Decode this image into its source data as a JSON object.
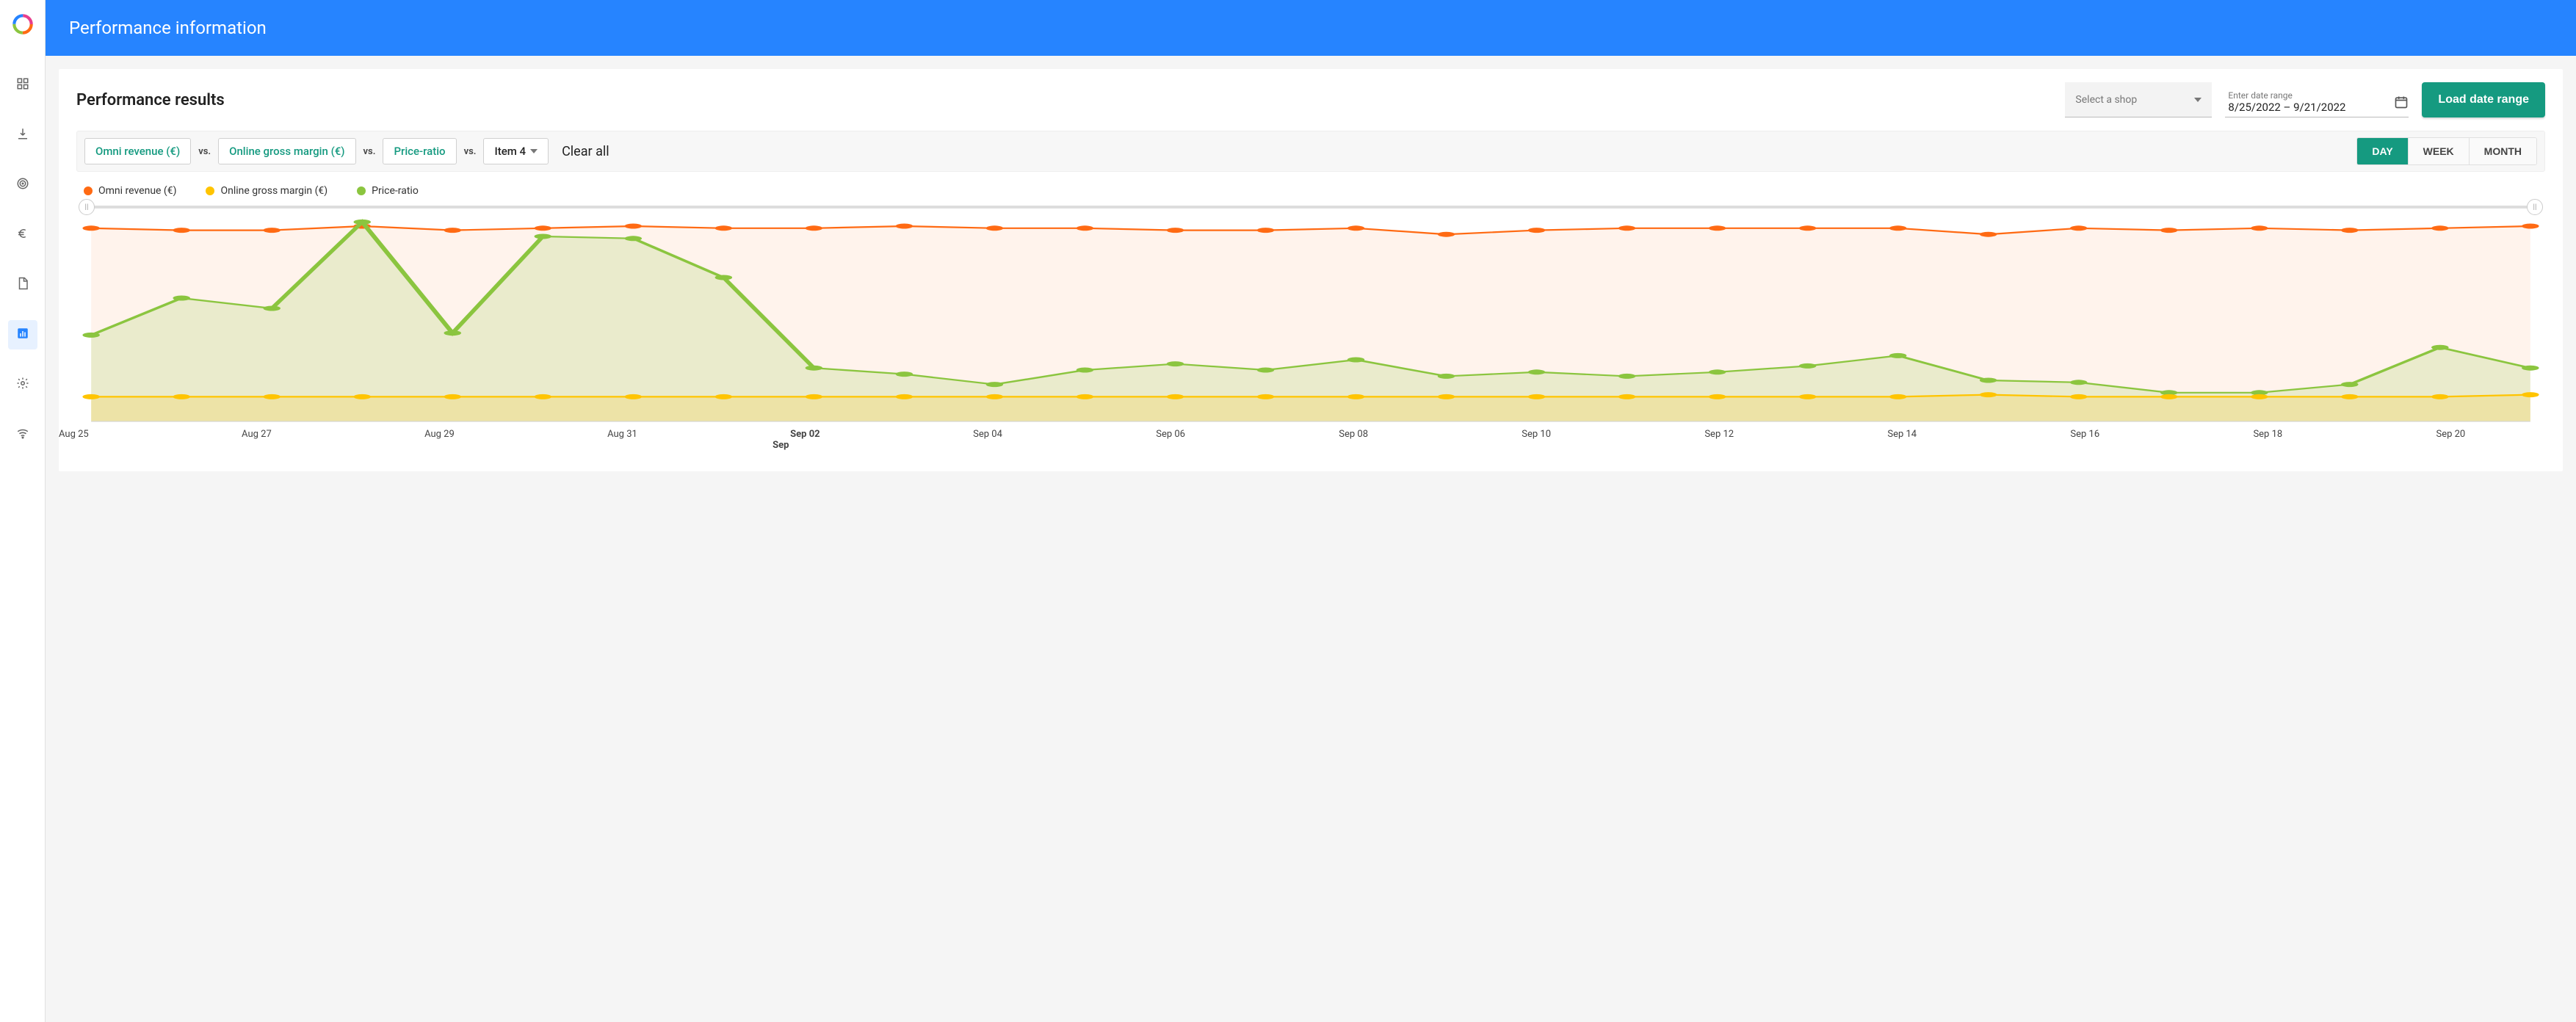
{
  "header": {
    "title": "Performance information"
  },
  "sidebar": {
    "icons": [
      "grid-icon",
      "download-icon",
      "radar-icon",
      "euro-icon",
      "file-icon",
      "chart-icon",
      "gear-icon",
      "wifi-icon"
    ],
    "active_index": 5
  },
  "card": {
    "title": "Performance results",
    "shop_select_placeholder": "Select a shop",
    "date_label": "Enter date range",
    "date_value": "8/25/2022 – 9/21/2022",
    "load_button": "Load date range"
  },
  "filters": {
    "metrics": [
      "Omni revenue (€)",
      "Online gross margin (€)",
      "Price-ratio"
    ],
    "vs_label": "vs.",
    "item4_label": "Item 4",
    "clear_all": "Clear all",
    "granularity": [
      "DAY",
      "WEEK",
      "MONTH"
    ],
    "granularity_active": 0
  },
  "legend": [
    {
      "label": "Omni revenue (€)",
      "color": "#ff6a13"
    },
    {
      "label": "Online gross margin (€)",
      "color": "#ffc400"
    },
    {
      "label": "Price-ratio",
      "color": "#8bc53f"
    }
  ],
  "chart_data": {
    "type": "line",
    "xlabel": "",
    "ylabel": "",
    "ylim": [
      0,
      100
    ],
    "categories": [
      "Aug 25",
      "Aug 26",
      "Aug 27",
      "Aug 28",
      "Aug 29",
      "Aug 30",
      "Aug 31",
      "Sep 01",
      "Sep 02",
      "Sep 03",
      "Sep 04",
      "Sep 05",
      "Sep 06",
      "Sep 07",
      "Sep 08",
      "Sep 09",
      "Sep 10",
      "Sep 11",
      "Sep 12",
      "Sep 13",
      "Sep 14",
      "Sep 15",
      "Sep 16",
      "Sep 17",
      "Sep 18",
      "Sep 19",
      "Sep 20",
      "Sep 21"
    ],
    "tick_labels": [
      "Aug 25",
      "Aug 27",
      "Aug 29",
      "Aug 31",
      "Sep 02",
      "Sep 04",
      "Sep 06",
      "Sep 08",
      "Sep 10",
      "Sep 12",
      "Sep 14",
      "Sep 16",
      "Sep 18",
      "Sep 20"
    ],
    "tick_sub": {
      "Sep 02": "Sep"
    },
    "series": [
      {
        "name": "Omni revenue (€)",
        "color": "#ff6a13",
        "fill": "rgba(255,106,19,0.08)",
        "values": [
          94,
          93,
          93,
          95,
          93,
          94,
          95,
          94,
          94,
          95,
          94,
          94,
          93,
          93,
          94,
          91,
          93,
          94,
          94,
          94,
          94,
          91,
          94,
          93,
          94,
          93,
          94,
          95
        ]
      },
      {
        "name": "Online gross margin (€)",
        "color": "#ffc400",
        "fill": "rgba(255,196,0,0.18)",
        "values": [
          12,
          12,
          12,
          12,
          12,
          12,
          12,
          12,
          12,
          12,
          12,
          12,
          12,
          12,
          12,
          12,
          12,
          12,
          12,
          12,
          12,
          13,
          12,
          12,
          12,
          12,
          12,
          13
        ]
      },
      {
        "name": "Price-ratio",
        "color": "#8bc53f",
        "fill": "rgba(139,197,63,0.18)",
        "values": [
          42,
          60,
          55,
          97,
          43,
          90,
          89,
          70,
          26,
          23,
          18,
          25,
          28,
          25,
          30,
          22,
          24,
          22,
          24,
          27,
          32,
          20,
          19,
          14,
          14,
          18,
          36,
          26
        ]
      }
    ]
  }
}
